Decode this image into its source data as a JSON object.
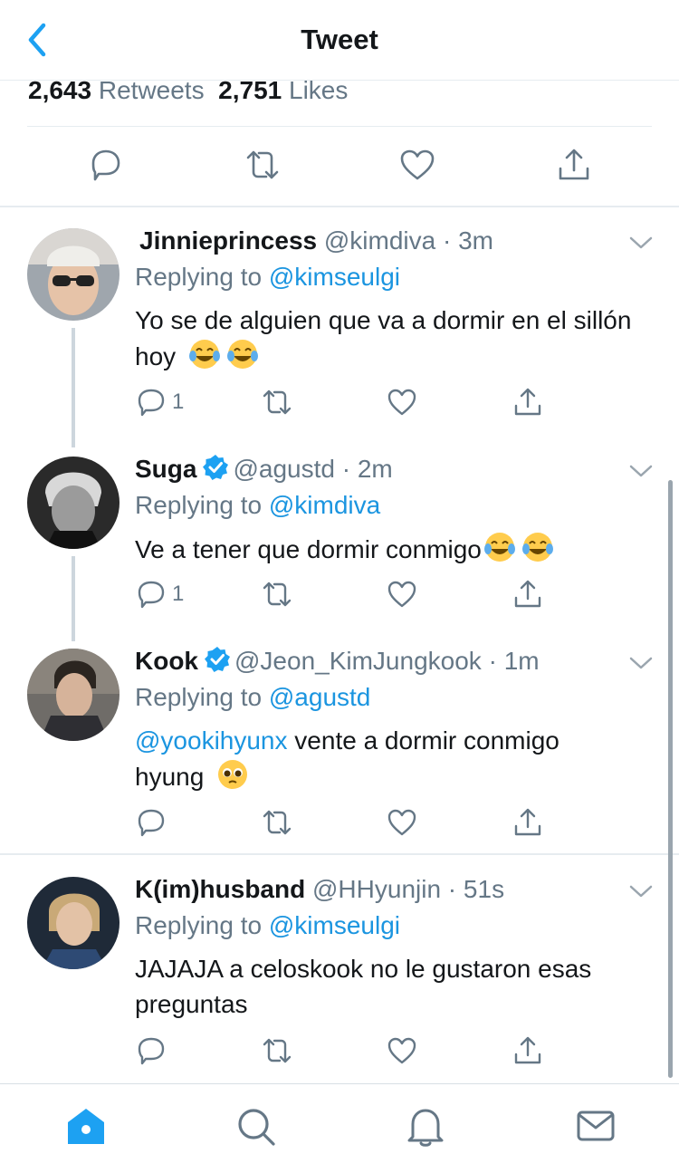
{
  "header": {
    "title": "Tweet",
    "back_icon": "chevron-left-icon",
    "accent": "#1da1f2"
  },
  "stats": {
    "retweets_count": "2,643",
    "retweets_label": "Retweets",
    "likes_count": "2,751",
    "likes_label": "Likes"
  },
  "actions": [
    "reply-icon",
    "retweet-icon",
    "like-icon",
    "share-icon"
  ],
  "replies": [
    {
      "name": "Jinnieprincess",
      "handle": "@kimdiva",
      "time": "3m",
      "replying_label": "Replying to",
      "replying_to": "@kimseulgi",
      "text": "Yo se de alguien que va a dormir en el sillón hoy",
      "emoji": [
        "joy-emoji",
        "joy-emoji"
      ],
      "reply_count": "1",
      "verified": false
    },
    {
      "name": "Suga",
      "handle": "@agustd",
      "time": "2m",
      "replying_label": "Replying to",
      "replying_to": "@kimdiva",
      "text": "Ve a tener que dormir conmigo",
      "emoji": [
        "joy-emoji",
        "joy-emoji"
      ],
      "reply_count": "1",
      "verified": true
    },
    {
      "name": "Kook",
      "handle": "@Jeon_KimJungkook",
      "time": "1m",
      "replying_label": "Replying to",
      "replying_to": "@agustd",
      "mention": "@yookihyunx",
      "text_after_mention": " vente a dormir conmigo",
      "text_line2": "hyung",
      "emoji": [
        "pleading-face-emoji"
      ],
      "reply_count": "",
      "verified": true
    },
    {
      "name": "K(im)husband",
      "handle": "@HHyunjin",
      "time": "51s",
      "replying_label": "Replying to",
      "replying_to": "@kimseulgi",
      "text": "JAJAJA a celoskook no le gustaron esas preguntas",
      "emoji": [],
      "reply_count": "",
      "verified": false
    }
  ],
  "tabbar": [
    "home-icon",
    "search-icon",
    "notifications-icon",
    "messages-icon"
  ]
}
